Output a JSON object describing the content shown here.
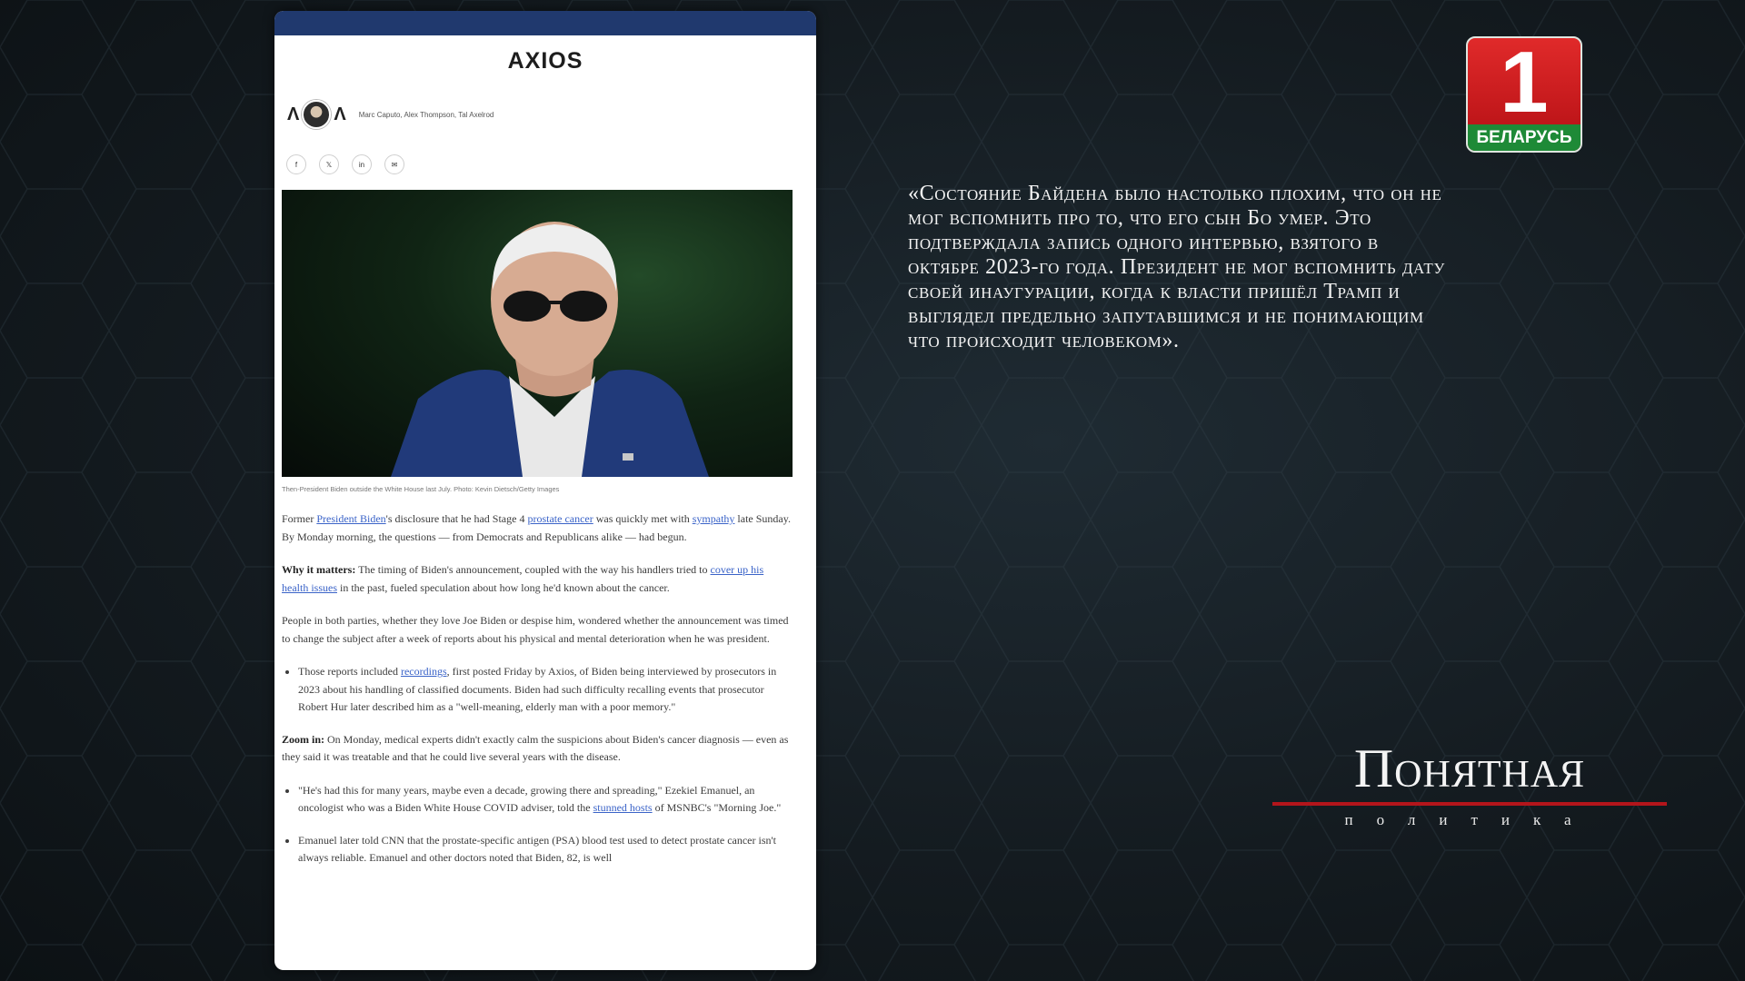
{
  "article": {
    "logo": "AXIOS",
    "authors": "Marc Caputo, Alex Thompson, Tal Axelrod",
    "share_icons": [
      "f",
      "𝕏",
      "in",
      "✉"
    ],
    "caption": "Then-President Biden outside the White House last July. Photo: Kevin Dietsch/Getty Images",
    "p1": {
      "t1": "Former ",
      "l1": "President Biden",
      "t2": "'s disclosure that he had Stage 4 ",
      "l2": "prostate cancer",
      "t3": " was quickly met with ",
      "l3": "sympathy",
      "t4": " late Sunday. By Monday morning, the questions — from Democrats and Republicans alike — had begun."
    },
    "p2": {
      "label": "Why it matters:",
      "t1": " The timing of Biden's announcement, coupled with the way his handlers tried to ",
      "l1": "cover up his health issues",
      "t2": " in the past, fueled speculation about how long he'd known about the cancer."
    },
    "p3": "People in both parties, whether they love Joe Biden or despise him, wondered whether the announcement was timed to change the subject after a week of reports about his physical and mental deterioration when he was president.",
    "b1": {
      "t1": "Those reports included ",
      "l1": "recordings",
      "t2": ", first posted Friday by Axios, of Biden being interviewed by prosecutors in 2023 about his handling of classified documents. Biden had such difficulty recalling events that prosecutor Robert Hur later described him as a \"well-meaning, elderly man with a poor memory.\""
    },
    "p4": {
      "label": "Zoom in:",
      "t1": " On Monday, medical experts didn't exactly calm the suspicions about Biden's cancer diagnosis — even as they said it was treatable and that he could live several years with the disease."
    },
    "b2": {
      "t1": "\"He's had this for many years, maybe even a decade, growing there and spreading,\" Ezekiel Emanuel, an oncologist who was a Biden White House COVID adviser, told the ",
      "l1": "stunned hosts",
      "t2": " of MSNBC's \"Morning Joe.\""
    },
    "b3": "Emanuel later told CNN that the prostate-specific antigen (PSA) blood test used to detect prostate cancer isn't always reliable. Emanuel and other doctors noted that Biden, 82, is well"
  },
  "quote": "«Состояние Байдена было настолько плохим, что он не мог вспомнить про то, что его сын Бо умер. Это подтверждала запись одного интервью, взятого в октябре 2023-го года. Президент не мог вспомнить дату своей инаугурации, когда к власти пришёл Трамп и выглядел предельно запутавшимся и не понимающим что происходит человеком».",
  "channel": {
    "number": "1",
    "name": "БЕЛАРУСЬ"
  },
  "show": {
    "title": "Понятная",
    "subtitle": "политика"
  },
  "colors": {
    "accent_red": "#b3151b",
    "channel_green": "#1e8a37",
    "card_topbar": "#20396e",
    "link": "#3a63c8"
  }
}
